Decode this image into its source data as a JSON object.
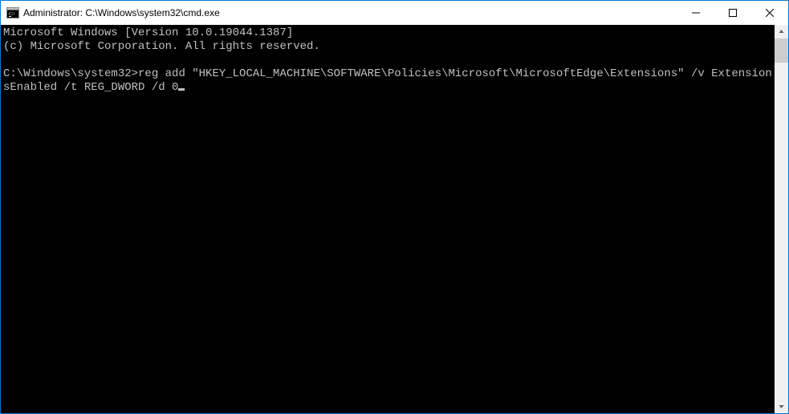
{
  "window": {
    "title": "Administrator: C:\\Windows\\system32\\cmd.exe"
  },
  "terminal": {
    "header_line1": "Microsoft Windows [Version 10.0.19044.1387]",
    "header_line2": "(c) Microsoft Corporation. All rights reserved.",
    "prompt": "C:\\Windows\\system32>",
    "command": "reg add \"HKEY_LOCAL_MACHINE\\SOFTWARE\\Policies\\Microsoft\\MicrosoftEdge\\Extensions\" /v ExtensionsEnabled /t REG_DWORD /d 0"
  }
}
